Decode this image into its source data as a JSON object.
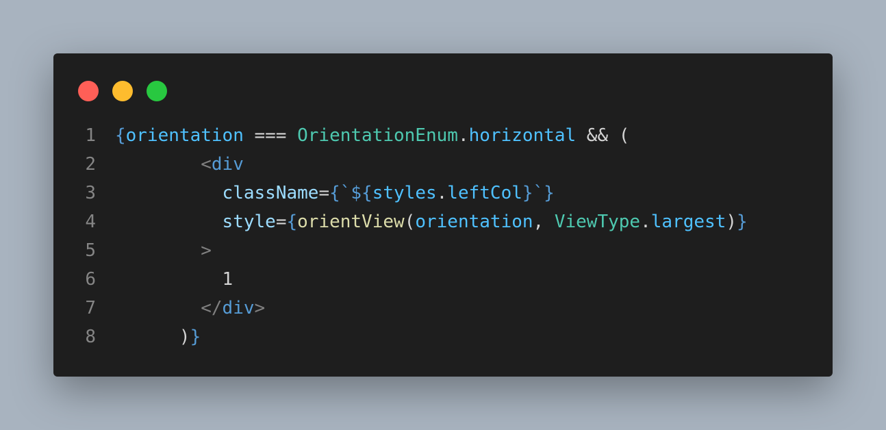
{
  "window": {
    "controls": [
      {
        "name": "close-dot",
        "color": "#ff5f57"
      },
      {
        "name": "minimize-dot",
        "color": "#febc2e"
      },
      {
        "name": "zoom-dot",
        "color": "#28c840"
      }
    ]
  },
  "colors": {
    "background": "#a8b3bf",
    "editor": "#1e1e1e",
    "line_number": "#858585",
    "brace": "#569cd6",
    "variable": "#4fc1ff",
    "property": "#9cdcfe",
    "type": "#4ec9b0",
    "function": "#dcdcaa",
    "operator": "#d4d4d4",
    "tag": "#569cd6",
    "tag_bracket": "#808080",
    "string": "#ce9178",
    "text": "#d4d4d4"
  },
  "code": {
    "lines": [
      {
        "number": "1",
        "tokens": [
          {
            "text": "{",
            "color": "#569cd6"
          },
          {
            "text": "orientation",
            "color": "#4fc1ff"
          },
          {
            "text": " === ",
            "color": "#d4d4d4"
          },
          {
            "text": "OrientationEnum",
            "color": "#4ec9b0"
          },
          {
            "text": ".",
            "color": "#d4d4d4"
          },
          {
            "text": "horizontal",
            "color": "#4fc1ff"
          },
          {
            "text": " && (",
            "color": "#d4d4d4"
          }
        ]
      },
      {
        "number": "2",
        "tokens": [
          {
            "text": "        ",
            "color": "#d4d4d4"
          },
          {
            "text": "<",
            "color": "#808080"
          },
          {
            "text": "div",
            "color": "#569cd6"
          }
        ]
      },
      {
        "number": "3",
        "tokens": [
          {
            "text": "          ",
            "color": "#d4d4d4"
          },
          {
            "text": "className",
            "color": "#9cdcfe"
          },
          {
            "text": "=",
            "color": "#d4d4d4"
          },
          {
            "text": "{`${",
            "color": "#569cd6"
          },
          {
            "text": "styles",
            "color": "#4fc1ff"
          },
          {
            "text": ".",
            "color": "#d4d4d4"
          },
          {
            "text": "leftCol",
            "color": "#4fc1ff"
          },
          {
            "text": "}`}",
            "color": "#569cd6"
          }
        ]
      },
      {
        "number": "4",
        "tokens": [
          {
            "text": "          ",
            "color": "#d4d4d4"
          },
          {
            "text": "style",
            "color": "#9cdcfe"
          },
          {
            "text": "=",
            "color": "#d4d4d4"
          },
          {
            "text": "{",
            "color": "#569cd6"
          },
          {
            "text": "orientView",
            "color": "#dcdcaa"
          },
          {
            "text": "(",
            "color": "#d4d4d4"
          },
          {
            "text": "orientation",
            "color": "#4fc1ff"
          },
          {
            "text": ", ",
            "color": "#d4d4d4"
          },
          {
            "text": "ViewType",
            "color": "#4ec9b0"
          },
          {
            "text": ".",
            "color": "#d4d4d4"
          },
          {
            "text": "largest",
            "color": "#4fc1ff"
          },
          {
            "text": ")",
            "color": "#d4d4d4"
          },
          {
            "text": "}",
            "color": "#569cd6"
          }
        ]
      },
      {
        "number": "5",
        "tokens": [
          {
            "text": "        ",
            "color": "#d4d4d4"
          },
          {
            "text": ">",
            "color": "#808080"
          }
        ]
      },
      {
        "number": "6",
        "tokens": [
          {
            "text": "          ",
            "color": "#d4d4d4"
          },
          {
            "text": "1",
            "color": "#d4d4d4"
          }
        ]
      },
      {
        "number": "7",
        "tokens": [
          {
            "text": "        ",
            "color": "#d4d4d4"
          },
          {
            "text": "</",
            "color": "#808080"
          },
          {
            "text": "div",
            "color": "#569cd6"
          },
          {
            "text": ">",
            "color": "#808080"
          }
        ]
      },
      {
        "number": "8",
        "tokens": [
          {
            "text": "      ",
            "color": "#d4d4d4"
          },
          {
            "text": ")",
            "color": "#d4d4d4"
          },
          {
            "text": "}",
            "color": "#569cd6"
          }
        ]
      }
    ]
  }
}
